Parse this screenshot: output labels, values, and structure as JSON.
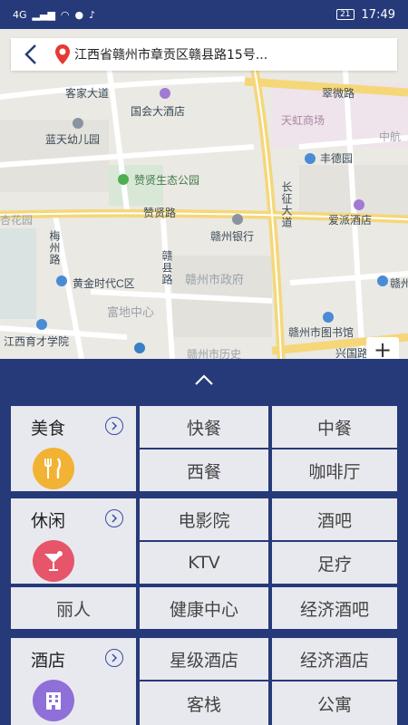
{
  "status_bar": {
    "network": "4G",
    "battery": "21",
    "time": "17:49"
  },
  "address_bar": {
    "text": "江西省赣州市章贡区赣县路15号..."
  },
  "map": {
    "labels": {
      "kejia_avenue": "客家大道",
      "guohui_hotel": "国会大酒店",
      "cuiwei_road": "翠微路",
      "tianhong_mall": "天虹商场",
      "zhonghang": "中航",
      "lantian_kindergarten": "蓝天幼儿园",
      "fengde_garden": "丰德园",
      "zanxian_park": "赞贤生态公园",
      "changzheng_avenue": "长征大道",
      "xinghuayuan": "杏花园",
      "zanxian_road": "赞贤路",
      "ganzhou_bank": "赣州银行",
      "aipai_hotel": "爱派酒店",
      "meizhou_road": "梅州路",
      "ganxian_road": "赣县路",
      "huangjin_times": "黄金时代C区",
      "ganzhou_gov": "赣州市政府",
      "ganzhou_edge": "赣州",
      "fudi_center": "富地中心",
      "ganzhou_library": "赣州市图书馆",
      "yucai_school": "江西育才学院",
      "xingguo_road": "兴国路",
      "ganzhou_history": "赣州市历史"
    },
    "zoom_in": "+"
  },
  "categories": [
    {
      "title": "美食",
      "icon": "fork-knife-icon",
      "color": "#f2b233",
      "items": [
        "快餐",
        "中餐",
        "西餐",
        "咖啡厅"
      ]
    },
    {
      "title": "休闲",
      "icon": "cocktail-icon",
      "color": "#e6556a",
      "items": [
        "电影院",
        "酒吧",
        "KTV",
        "足疗"
      ],
      "extra_row": [
        "丽人",
        "健康中心",
        "经济酒吧"
      ]
    },
    {
      "title": "酒店",
      "icon": "building-icon",
      "color": "#8f6fd8",
      "items": [
        "星级酒店",
        "经济酒店",
        "客栈",
        "公寓"
      ]
    }
  ],
  "colors": {
    "navy": "#263a7a",
    "cell_bg": "#e8e9ee",
    "road_yellow": "#f5d77a"
  }
}
